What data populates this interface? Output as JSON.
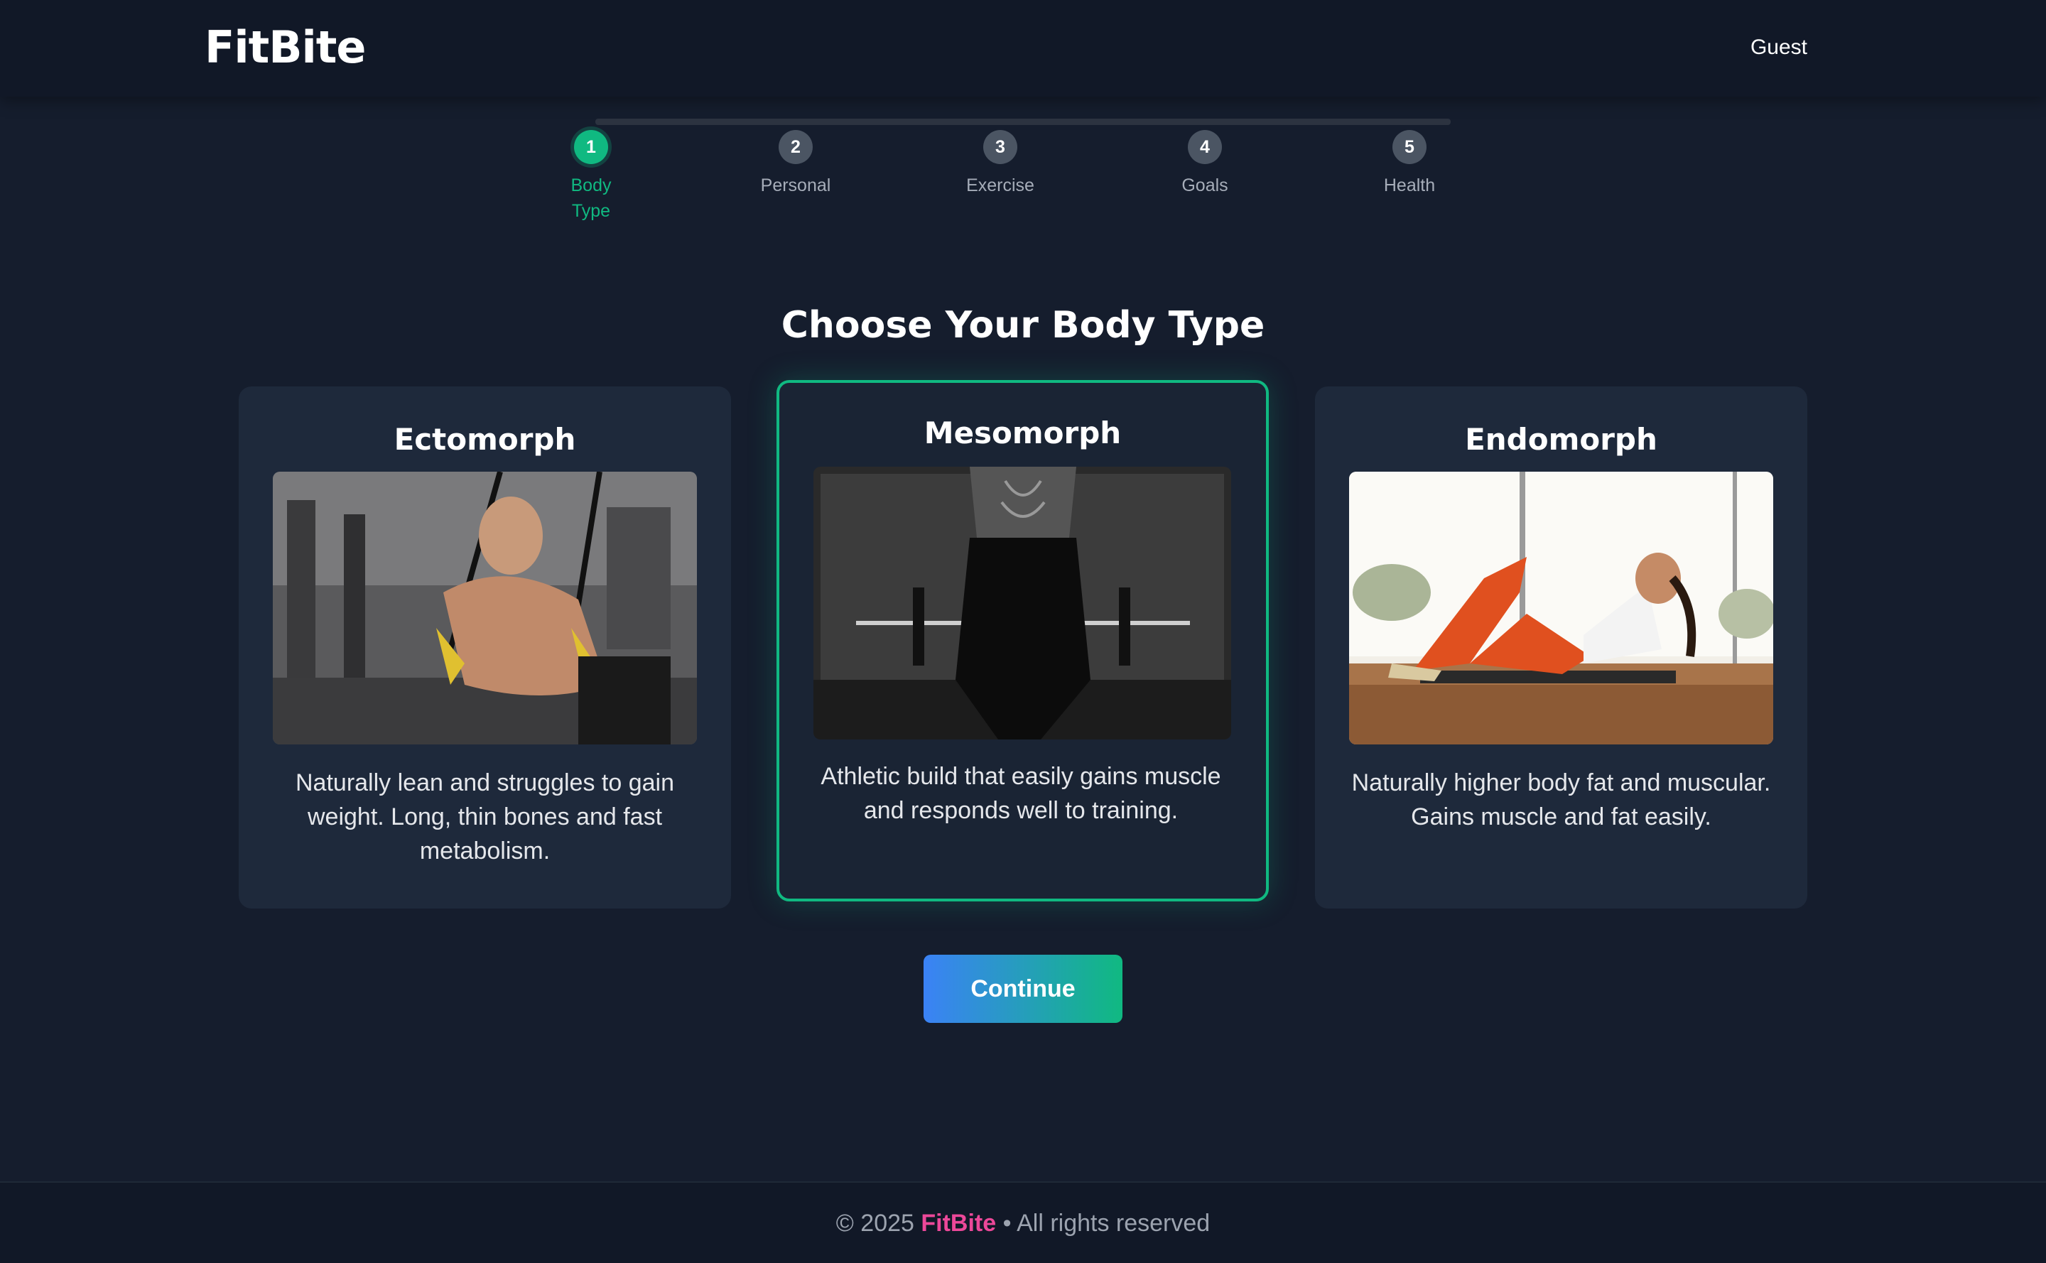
{
  "app": {
    "logo": "FitBite",
    "user": "Guest"
  },
  "stepper": {
    "steps": [
      {
        "number": "1",
        "label": "Body Type",
        "active": true
      },
      {
        "number": "2",
        "label": "Personal",
        "active": false
      },
      {
        "number": "3",
        "label": "Exercise",
        "active": false
      },
      {
        "number": "4",
        "label": "Goals",
        "active": false
      },
      {
        "number": "5",
        "label": "Health",
        "active": false
      }
    ]
  },
  "main": {
    "title": "Choose Your Body Type",
    "cards": [
      {
        "title": "Ectomorph",
        "description": "Naturally lean and struggles to gain weight. Long, thin bones and fast metabolism.",
        "selected": false
      },
      {
        "title": "Mesomorph",
        "description": "Athletic build that easily gains muscle and responds well to training.",
        "selected": true
      },
      {
        "title": "Endomorph",
        "description": "Naturally higher body fat and muscular. Gains muscle and fat easily.",
        "selected": false
      }
    ],
    "continue_label": "Continue"
  },
  "footer": {
    "prefix": "© 2025",
    "brand": "FitBite",
    "suffix": "• All rights reserved"
  },
  "colors": {
    "accent_green": "#10b981",
    "accent_blue": "#3b82f6",
    "brand_pink": "#ec4899",
    "background": "#151d2d",
    "card": "#1e293b"
  }
}
